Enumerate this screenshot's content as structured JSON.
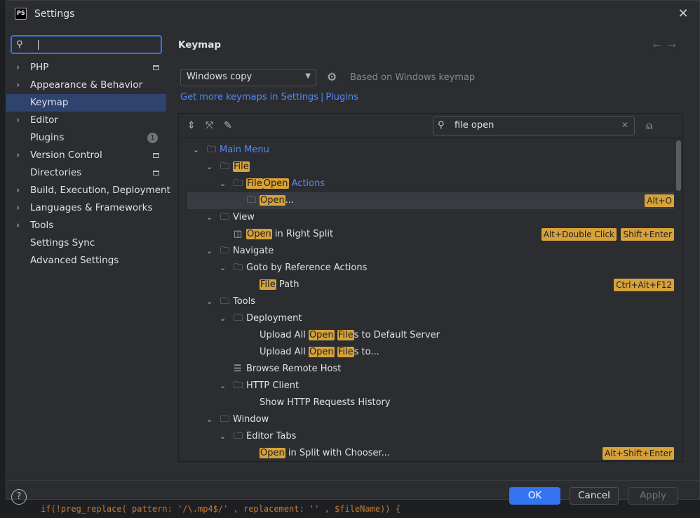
{
  "window": {
    "title": "Settings",
    "logo": "PS"
  },
  "sidebar": {
    "search_value": "",
    "items": [
      {
        "label": "PHP",
        "chevron": true,
        "project": true
      },
      {
        "label": "Appearance & Behavior",
        "chevron": true
      },
      {
        "label": "Keymap",
        "selected": true
      },
      {
        "label": "Editor",
        "chevron": true
      },
      {
        "label": "Plugins",
        "badge": "1"
      },
      {
        "label": "Version Control",
        "chevron": true,
        "project": true
      },
      {
        "label": "Directories",
        "project": true
      },
      {
        "label": "Build, Execution, Deployment",
        "chevron": true
      },
      {
        "label": "Languages & Frameworks",
        "chevron": true
      },
      {
        "label": "Tools",
        "chevron": true
      },
      {
        "label": "Settings Sync"
      },
      {
        "label": "Advanced Settings"
      }
    ]
  },
  "main": {
    "heading": "Keymap",
    "keymap_select": "Windows copy",
    "based_on": "Based on Windows keymap",
    "links": {
      "prefix": "Get more keymaps in Settings",
      "sep": "|",
      "plugins": "Plugins"
    },
    "filter_value": "file open"
  },
  "tree": [
    {
      "level": 0,
      "expanded": true,
      "icon": "folder",
      "parts": [
        [
          "Main Menu",
          "blue"
        ]
      ]
    },
    {
      "level": 1,
      "expanded": true,
      "icon": "folder",
      "parts": [
        [
          "File",
          "hl"
        ]
      ]
    },
    {
      "level": 2,
      "expanded": true,
      "icon": "folder",
      "parts": [
        [
          "File",
          "hl"
        ],
        [
          "Open",
          "hl"
        ],
        [
          " Actions",
          "blue"
        ]
      ]
    },
    {
      "level": 3,
      "icon": "folder",
      "selected": true,
      "parts": [
        [
          "Open",
          "hl"
        ],
        [
          "...",
          ""
        ]
      ],
      "shortcuts": [
        "Alt+O"
      ]
    },
    {
      "level": 1,
      "expanded": true,
      "icon": "folder",
      "parts": [
        [
          "View",
          ""
        ]
      ]
    },
    {
      "level": 2,
      "icon": "split",
      "parts": [
        [
          "Open",
          "hl"
        ],
        [
          " in Right Split",
          ""
        ]
      ],
      "shortcuts": [
        "Shift+Enter",
        "Alt+Double Click"
      ]
    },
    {
      "level": 1,
      "expanded": true,
      "icon": "folder",
      "parts": [
        [
          "Navigate",
          ""
        ]
      ]
    },
    {
      "level": 2,
      "expanded": true,
      "icon": "folder",
      "parts": [
        [
          "Goto by Reference Actions",
          ""
        ]
      ]
    },
    {
      "level": 3,
      "icon": "none",
      "parts": [
        [
          "File",
          "hl"
        ],
        [
          " Path",
          ""
        ]
      ],
      "shortcuts": [
        "Ctrl+Alt+F12"
      ]
    },
    {
      "level": 1,
      "expanded": true,
      "icon": "folder",
      "parts": [
        [
          "Tools",
          ""
        ]
      ]
    },
    {
      "level": 2,
      "expanded": true,
      "icon": "folder",
      "parts": [
        [
          "Deployment",
          ""
        ]
      ]
    },
    {
      "level": 3,
      "icon": "none",
      "parts": [
        [
          "Upload All ",
          ""
        ],
        [
          "Open",
          "hl"
        ],
        [
          " ",
          ""
        ],
        [
          "File",
          "hl"
        ],
        [
          "s to Default Server",
          ""
        ]
      ]
    },
    {
      "level": 3,
      "icon": "none",
      "parts": [
        [
          "Upload All ",
          ""
        ],
        [
          "Open",
          "hl"
        ],
        [
          " ",
          ""
        ],
        [
          "File",
          "hl"
        ],
        [
          "s to...",
          ""
        ]
      ]
    },
    {
      "level": 2,
      "icon": "server",
      "parts": [
        [
          "Browse Remote Host",
          ""
        ]
      ]
    },
    {
      "level": 2,
      "expanded": true,
      "icon": "folder",
      "parts": [
        [
          "HTTP Client",
          ""
        ]
      ]
    },
    {
      "level": 3,
      "icon": "none",
      "parts": [
        [
          "Show HTTP Requests History",
          ""
        ]
      ]
    },
    {
      "level": 1,
      "expanded": true,
      "icon": "folder",
      "parts": [
        [
          "Window",
          ""
        ]
      ]
    },
    {
      "level": 2,
      "expanded": true,
      "icon": "folder",
      "parts": [
        [
          "Editor Tabs",
          ""
        ]
      ]
    },
    {
      "level": 3,
      "icon": "none",
      "parts": [
        [
          "Open",
          "hl"
        ],
        [
          " in Split with Chooser...",
          ""
        ]
      ],
      "shortcuts": [
        "Alt+Shift+Enter"
      ]
    }
  ],
  "footer": {
    "help": "?",
    "ok": "OK",
    "cancel": "Cancel",
    "apply": "Apply"
  },
  "background_code": {
    "prefix": "if(!preg_replace( pattern: '/\\.mp4$/' , replacement: '' , $fileName)) {"
  },
  "colors": {
    "accent": "#3574f0",
    "highlight": "#d6a23a",
    "selection": "#2e436e",
    "link": "#548af7"
  }
}
